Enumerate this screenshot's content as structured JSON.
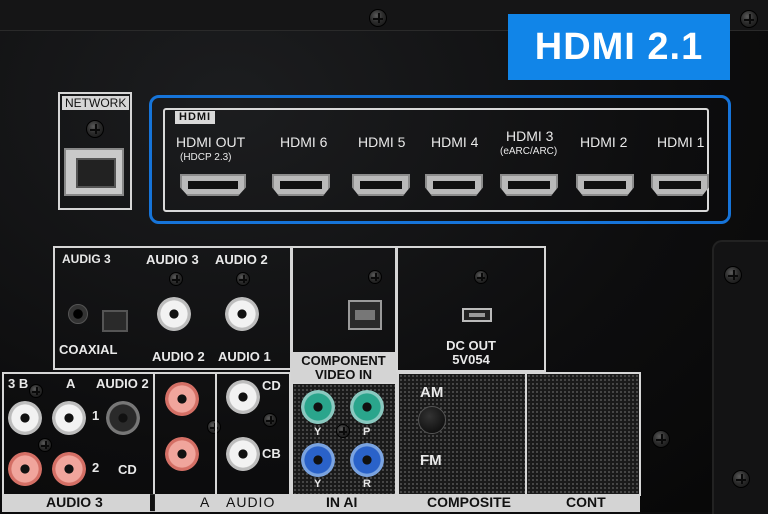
{
  "badge": {
    "text": "HDMI 2.1",
    "color": "#1185e8"
  },
  "network": {
    "label": "NETWORK",
    "port_icon": "rj45-jack-icon"
  },
  "hdmi": {
    "logo": "HDMI",
    "highlight_color": "#1674d9",
    "ports": [
      {
        "label": "HDMI OUT",
        "sub": "(HDCP 2.3)"
      },
      {
        "label": "HDMI 6",
        "sub": ""
      },
      {
        "label": "HDMI 5",
        "sub": ""
      },
      {
        "label": "HDMI 4",
        "sub": ""
      },
      {
        "label": "HDMI 3",
        "sub": "(eARC/ARC)"
      },
      {
        "label": "HDMI 2",
        "sub": ""
      },
      {
        "label": "HDMI 1",
        "sub": ""
      }
    ]
  },
  "audio_top": {
    "col1_label": "AUDIG  3",
    "col1_bottom": "COAXIAL",
    "col2_label": "AUDIO 3",
    "col2_bottom": "AUDIO 2",
    "col3_label": "AUDIO 2",
    "col3_bottom": "AUDIO 1"
  },
  "component": {
    "title": "COMPONENT",
    "subtitle": "VIDEO IN",
    "y": "Y",
    "p": "P",
    "y2": "Y",
    "r": "R"
  },
  "dc_out": {
    "line1": "DC OUT",
    "line2": "5V054"
  },
  "audio_bottom": {
    "label_3b": "3 B",
    "label_a": "A",
    "label_audio2": "AUDIO 2",
    "label_1": "1",
    "label_2": "2",
    "label_cd": "CD",
    "label_cd2": "CD",
    "label_cb": "CB"
  },
  "bottom_bar": {
    "audio3": "AUDIO 3",
    "mark": "▌",
    "a": "A",
    "audio": "AUDIO",
    "inai": "IN AI",
    "composite": "COMPOSITE",
    "cont": "CONT"
  },
  "am_fm": {
    "am": "AM",
    "fm": "FM"
  }
}
